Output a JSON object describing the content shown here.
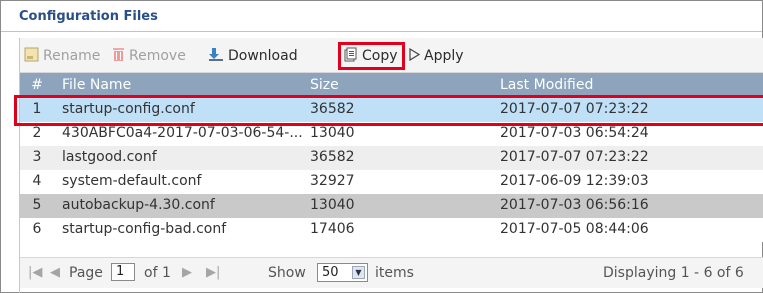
{
  "panel": {
    "title": "Configuration Files"
  },
  "toolbar": {
    "rename_label": "Rename",
    "remove_label": "Remove",
    "download_label": "Download",
    "copy_label": "Copy",
    "apply_label": "Apply"
  },
  "table": {
    "columns": [
      "#",
      "File Name",
      "Size",
      "Last Modified"
    ],
    "rows": [
      {
        "num": "1",
        "file": "startup-config.conf",
        "size": "36582",
        "modified": "2017-07-07 07:23:22",
        "selected": true
      },
      {
        "num": "2",
        "file": "430ABFC0a4-2017-07-03-06-54-...",
        "size": "13040",
        "modified": "2017-07-03 06:54:24"
      },
      {
        "num": "3",
        "file": "lastgood.conf",
        "size": "36582",
        "modified": "2017-07-07 07:23:22"
      },
      {
        "num": "4",
        "file": "system-default.conf",
        "size": "32927",
        "modified": "2017-06-09 12:39:03"
      },
      {
        "num": "5",
        "file": "autobackup-4.30.conf",
        "size": "13040",
        "modified": "2017-07-03 06:56:16"
      },
      {
        "num": "6",
        "file": "startup-config-bad.conf",
        "size": "17406",
        "modified": "2017-07-05 08:44:06"
      }
    ]
  },
  "pager": {
    "page_label": "Page",
    "page_value": "1",
    "of_label": "of 1",
    "show_label": "Show",
    "show_value": "50",
    "items_label": "items",
    "display_text": "Displaying 1 - 6 of 6"
  },
  "colors": {
    "header_bg": "#8ea4bc",
    "title": "#2a4f87",
    "highlight_border": "#e0001b",
    "selected_row": "#bfe0f7"
  },
  "icons": [
    "rename-icon",
    "remove-icon",
    "download-icon",
    "copy-icon",
    "apply-icon",
    "first-page-icon",
    "prev-page-icon",
    "next-page-icon",
    "last-page-icon",
    "chevron-down-icon"
  ]
}
